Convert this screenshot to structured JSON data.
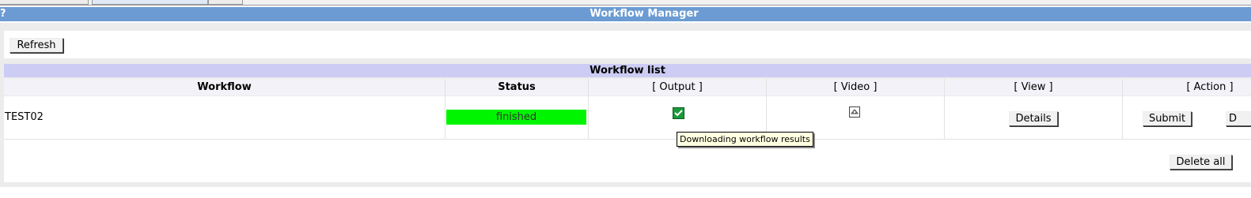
{
  "window": {
    "help_glyph": "?",
    "title": "Workflow Manager"
  },
  "toolbar": {
    "refresh_label": "Refresh"
  },
  "workflow_list": {
    "heading": "Workflow list",
    "columns": [
      "Workflow",
      "Status",
      "[ Output ]",
      "[ Video ]",
      "[ View ]",
      "[ Action ]"
    ],
    "rows": [
      {
        "workflow": "TEST02",
        "status": "finished",
        "status_color": "#00f600",
        "output_icon": "checkmark-icon",
        "video_icon": "video-icon",
        "view_button": "Details",
        "action_submit": "Submit",
        "action_other_partial": "D"
      }
    ],
    "tooltip": "Downloading workflow results",
    "delete_all_label": "Delete all"
  },
  "colors": {
    "titlebar": "#6b9bd2",
    "list_header": "#ccccf4",
    "status_finished": "#00f600"
  }
}
